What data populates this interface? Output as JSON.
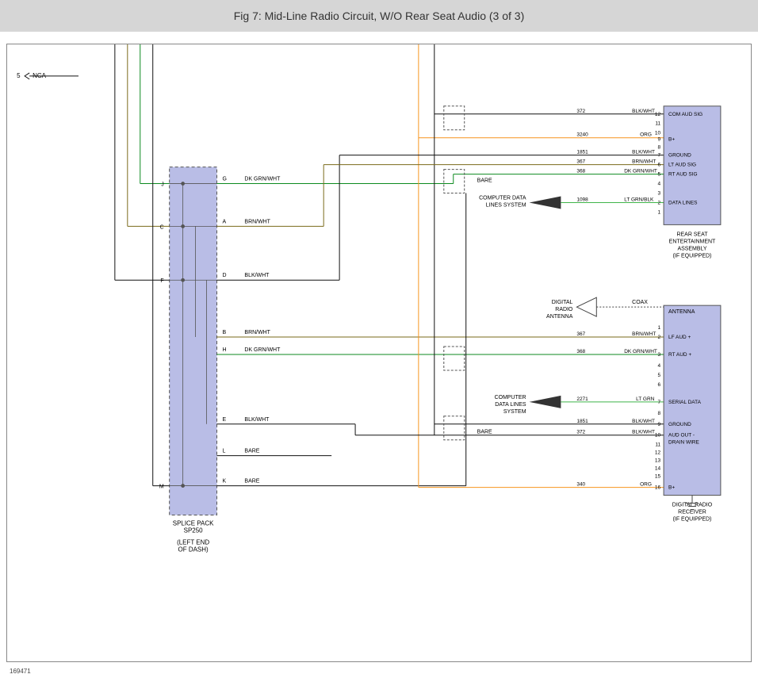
{
  "title": "Fig 7: Mid-Line Radio Circuit, W/O Rear Seat Audio (3 of 3)",
  "doc_id": "169471",
  "nca": "NCA",
  "nca_pin": "5",
  "splice": {
    "name": "SPLICE PACK\nSP250",
    "loc": "(LEFT END\nOF DASH)",
    "left": {
      "J": "J",
      "C": "C",
      "F": "F",
      "M": "M"
    },
    "right": {
      "G": "G",
      "A": "A",
      "D": "D",
      "B": "B",
      "H": "H",
      "E": "E",
      "L": "L",
      "K": "K"
    },
    "colors": {
      "G": "DK GRN/WHT",
      "A": "BRN/WHT",
      "D": "BLK/WHT",
      "B": "BRN/WHT",
      "H": "DK GRN/WHT",
      "E": "BLK/WHT",
      "L": "BARE",
      "K": "BARE"
    }
  },
  "bare": "BARE",
  "rse": {
    "name": "REAR SEAT\nENTERTAINMENT\nASSEMBLY\n(IF EQUIPPED)",
    "pins": {
      "12": "COM AUD SIG",
      "11": "",
      "10": "",
      "9": "B+",
      "8": "",
      "7": "GROUND",
      "6": "LT AUD SIG",
      "5": "RT AUD SIG",
      "4": "",
      "3": "",
      "2": "DATA LINES",
      "1": ""
    },
    "wires": {
      "12": {
        "id": "372",
        "col": "BLK/WHT"
      },
      "9": {
        "id": "3240",
        "col": "ORG"
      },
      "7": {
        "id": "1851",
        "col": "BLK/WHT"
      },
      "6": {
        "id": "367",
        "col": "BRN/WHT"
      },
      "5": {
        "id": "368",
        "col": "DK GRN/WHT"
      },
      "2": {
        "id": "1098",
        "col": "LT GRN/BLK"
      }
    },
    "dl_ref": "COMPUTER DATA\nLINES SYSTEM"
  },
  "drr": {
    "name": "DIGITAL RADIO\nRECEIVER\n(IF EQUIPPED)",
    "ant": {
      "label": "DIGITAL\nRADIO\nANTENNA",
      "col": "COAX",
      "sig": "ANTENNA"
    },
    "pins": {
      "1": "",
      "2": "LF AUD +",
      "3": "RT AUD +",
      "4": "",
      "5": "",
      "6": "",
      "7": "SERIAL DATA",
      "8": "",
      "9": "GROUND",
      "10": "AUD OUT -\nDRAIN WIRE",
      "11": "",
      "12": "",
      "13": "",
      "14": "",
      "15": "",
      "16": "B+"
    },
    "wires": {
      "2": {
        "id": "367",
        "col": "BRN/WHT"
      },
      "3": {
        "id": "368",
        "col": "DK GRN/WHT"
      },
      "7": {
        "id": "2271",
        "col": "LT GRN"
      },
      "9": {
        "id": "1851",
        "col": "BLK/WHT"
      },
      "10": {
        "id": "372",
        "col": "BLK/WHT"
      },
      "16": {
        "id": "340",
        "col": "ORG"
      }
    },
    "dl_ref": "COMPUTER\nDATA LINES\nSYSTEM"
  },
  "colors": {
    "black": "#111",
    "olive": "#7a6a1a",
    "green": "#0c8a1f",
    "ltgreen": "#3fb54a",
    "orange": "#f7941e",
    "bare": "#111"
  }
}
